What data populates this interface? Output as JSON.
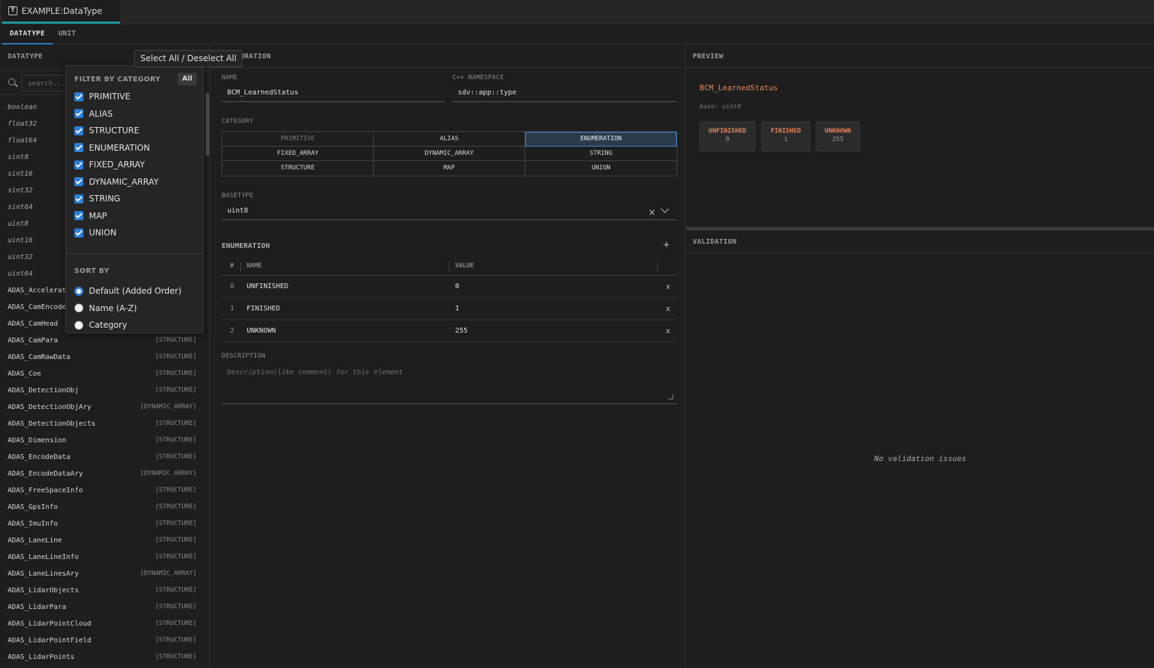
{
  "editor_tab": {
    "title": "EXAMPLE:DataType",
    "icon": "type-file-icon"
  },
  "subtabs": [
    {
      "label": "DATATYPE",
      "active": true
    },
    {
      "label": "UNIT",
      "active": false
    }
  ],
  "left": {
    "title": "DATATYPE",
    "search_placeholder": "search...",
    "types": [
      {
        "name": "boolean",
        "cat": "",
        "prim": true
      },
      {
        "name": "float32",
        "cat": "",
        "prim": true
      },
      {
        "name": "float64",
        "cat": "",
        "prim": true
      },
      {
        "name": "sint8",
        "cat": "",
        "prim": true
      },
      {
        "name": "sint16",
        "cat": "",
        "prim": true
      },
      {
        "name": "sint32",
        "cat": "",
        "prim": true
      },
      {
        "name": "sint64",
        "cat": "",
        "prim": true
      },
      {
        "name": "uint8",
        "cat": "",
        "prim": true
      },
      {
        "name": "uint16",
        "cat": "",
        "prim": true
      },
      {
        "name": "uint32",
        "cat": "",
        "prim": true
      },
      {
        "name": "uint64",
        "cat": "",
        "prim": true
      },
      {
        "name": "ADAS_Accelerati",
        "cat": "",
        "prim": false
      },
      {
        "name": "ADAS_CamEncodeD",
        "cat": "",
        "prim": false
      },
      {
        "name": "ADAS_CamHead",
        "cat": "",
        "prim": false
      },
      {
        "name": "ADAS_CamPara",
        "cat": "[STRUCTURE]",
        "prim": false
      },
      {
        "name": "ADAS_CamRawData",
        "cat": "[STRUCTURE]",
        "prim": false
      },
      {
        "name": "ADAS_Coe",
        "cat": "[STRUCTURE]",
        "prim": false
      },
      {
        "name": "ADAS_DetectionObj",
        "cat": "[STRUCTURE]",
        "prim": false
      },
      {
        "name": "ADAS_DetectionObjAry",
        "cat": "[DYNAMIC_ARRAY]",
        "prim": false
      },
      {
        "name": "ADAS_DetectionObjects",
        "cat": "[STRUCTURE]",
        "prim": false
      },
      {
        "name": "ADAS_Dimension",
        "cat": "[STRUCTURE]",
        "prim": false
      },
      {
        "name": "ADAS_EncodeData",
        "cat": "[STRUCTURE]",
        "prim": false
      },
      {
        "name": "ADAS_EncodeDataAry",
        "cat": "[DYNAMIC_ARRAY]",
        "prim": false
      },
      {
        "name": "ADAS_FreeSpaceInfo",
        "cat": "[STRUCTURE]",
        "prim": false
      },
      {
        "name": "ADAS_GpsInfo",
        "cat": "[STRUCTURE]",
        "prim": false
      },
      {
        "name": "ADAS_ImuInfo",
        "cat": "[STRUCTURE]",
        "prim": false
      },
      {
        "name": "ADAS_LaneLine",
        "cat": "[STRUCTURE]",
        "prim": false
      },
      {
        "name": "ADAS_LaneLineInfo",
        "cat": "[STRUCTURE]",
        "prim": false
      },
      {
        "name": "ADAS_LaneLinesAry",
        "cat": "[DYNAMIC_ARRAY]",
        "prim": false
      },
      {
        "name": "ADAS_LidarObjects",
        "cat": "[STRUCTURE]",
        "prim": false
      },
      {
        "name": "ADAS_LidarPara",
        "cat": "[STRUCTURE]",
        "prim": false
      },
      {
        "name": "ADAS_LidarPointCloud",
        "cat": "[STRUCTURE]",
        "prim": false
      },
      {
        "name": "ADAS_LidarPointField",
        "cat": "[STRUCTURE]",
        "prim": false
      },
      {
        "name": "ADAS_LidarPoints",
        "cat": "[STRUCTURE]",
        "prim": false
      }
    ]
  },
  "tooltip": "Select All / Deselect All",
  "filter": {
    "header": "FILTER BY CATEGORY",
    "all_label": "All",
    "categories": [
      "PRIMITIVE",
      "ALIAS",
      "STRUCTURE",
      "ENUMERATION",
      "FIXED_ARRAY",
      "DYNAMIC_ARRAY",
      "STRING",
      "MAP",
      "UNION"
    ],
    "sort_header": "SORT BY",
    "sort_options": [
      {
        "label": "Default (Added Order)",
        "selected": true
      },
      {
        "label": "Name (A-Z)",
        "selected": false
      },
      {
        "label": "Category",
        "selected": false
      }
    ]
  },
  "config": {
    "title_partial": "IGURATION",
    "name_label": "NAME",
    "name_value": "BCM_LearnedStatus",
    "namespace_label": "C++ NAMESPACE",
    "namespace_value": "sdv::app::type",
    "category_label": "CATEGORY",
    "categories": [
      {
        "label": "PRIMITIVE",
        "state": "dim"
      },
      {
        "label": "ALIAS",
        "state": ""
      },
      {
        "label": "ENUMERATION",
        "state": "sel"
      },
      {
        "label": "FIXED_ARRAY",
        "state": ""
      },
      {
        "label": "DYNAMIC_ARRAY",
        "state": ""
      },
      {
        "label": "STRING",
        "state": ""
      },
      {
        "label": "STRUCTURE",
        "state": ""
      },
      {
        "label": "MAP",
        "state": ""
      },
      {
        "label": "UNION",
        "state": ""
      }
    ],
    "basetype_label": "BASETYPE",
    "basetype_value": "uint8",
    "enumeration_label": "ENUMERATION",
    "enum_headers": {
      "idx": "#",
      "name": "NAME",
      "value": "VALUE"
    },
    "enum_rows": [
      {
        "idx": "0",
        "name": "UNFINISHED",
        "value": "0"
      },
      {
        "idx": "1",
        "name": "FINISHED",
        "value": "1"
      },
      {
        "idx": "2",
        "name": "UNKNOWN",
        "value": "255"
      }
    ],
    "delete_symbol": "x",
    "add_symbol": "+",
    "clear_symbol": "×",
    "description_label": "DESCRIPTION",
    "description_placeholder": "Description(like comment) for this element"
  },
  "preview": {
    "title": "PREVIEW",
    "type_name": "BCM_LearnedStatus",
    "base": "base: uint8",
    "badges": [
      {
        "name": "UNFINISHED",
        "value": "0"
      },
      {
        "name": "FINISHED",
        "value": "1"
      },
      {
        "name": "UNKNOWN",
        "value": "255"
      }
    ]
  },
  "validation": {
    "title": "VALIDATION",
    "empty_text": "No validation issues"
  },
  "colors": {
    "accent_blue": "#2b7fd8",
    "accent_teal": "#1a9ea1",
    "preview_orange": "#e8855a"
  }
}
